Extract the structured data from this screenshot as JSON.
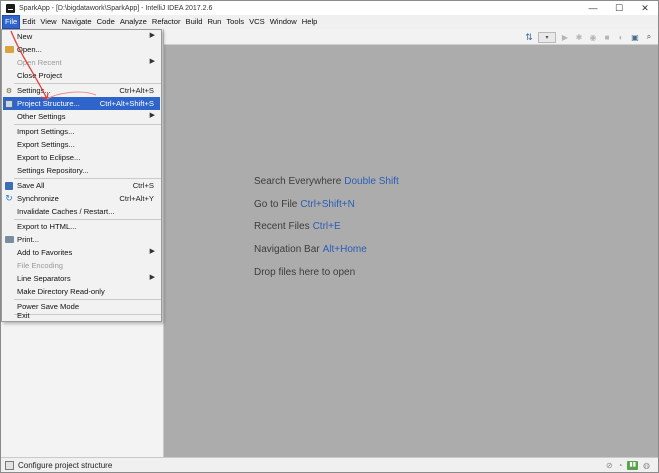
{
  "window": {
    "title": "SparkApp - [D:\\bigdatawork\\SparkApp] - IntelliJ IDEA 2017.2.6",
    "controls": {
      "minimize": "—",
      "maximize": "☐",
      "close": "✕"
    }
  },
  "menubar": {
    "items": [
      {
        "label": "File"
      },
      {
        "label": "Edit"
      },
      {
        "label": "View"
      },
      {
        "label": "Navigate"
      },
      {
        "label": "Code"
      },
      {
        "label": "Analyze"
      },
      {
        "label": "Refactor"
      },
      {
        "label": "Build"
      },
      {
        "label": "Run"
      },
      {
        "label": "Tools"
      },
      {
        "label": "VCS"
      },
      {
        "label": "Window"
      },
      {
        "label": "Help"
      }
    ]
  },
  "file_menu": {
    "items": [
      {
        "label": "New",
        "shortcut": "",
        "submenu": true,
        "disabled": false,
        "icon": ""
      },
      {
        "label": "Open...",
        "shortcut": "",
        "submenu": false,
        "disabled": false,
        "icon": "folder-icon"
      },
      {
        "label": "Open Recent",
        "shortcut": "",
        "submenu": true,
        "disabled": true,
        "icon": ""
      },
      {
        "label": "Close Project",
        "shortcut": "",
        "submenu": false,
        "disabled": false,
        "icon": ""
      },
      {
        "label": "Settings...",
        "shortcut": "Ctrl+Alt+S",
        "submenu": false,
        "disabled": false,
        "icon": "wrench-icon"
      },
      {
        "label": "Project Structure...",
        "shortcut": "Ctrl+Alt+Shift+S",
        "submenu": false,
        "disabled": false,
        "selected": true,
        "icon": "project-structure-icon"
      },
      {
        "label": "Other Settings",
        "shortcut": "",
        "submenu": true,
        "disabled": false,
        "icon": ""
      },
      {
        "label": "Import Settings...",
        "shortcut": "",
        "submenu": false,
        "disabled": false,
        "icon": ""
      },
      {
        "label": "Export Settings...",
        "shortcut": "",
        "submenu": false,
        "disabled": false,
        "icon": ""
      },
      {
        "label": "Export to Eclipse...",
        "shortcut": "",
        "submenu": false,
        "disabled": false,
        "icon": ""
      },
      {
        "label": "Settings Repository...",
        "shortcut": "",
        "submenu": false,
        "disabled": false,
        "icon": ""
      },
      {
        "label": "Save All",
        "shortcut": "Ctrl+S",
        "submenu": false,
        "disabled": false,
        "icon": "save-icon"
      },
      {
        "label": "Synchronize",
        "shortcut": "Ctrl+Alt+Y",
        "submenu": false,
        "disabled": false,
        "icon": "sync-icon"
      },
      {
        "label": "Invalidate Caches / Restart...",
        "shortcut": "",
        "submenu": false,
        "disabled": false,
        "icon": ""
      },
      {
        "label": "Export to HTML...",
        "shortcut": "",
        "submenu": false,
        "disabled": false,
        "icon": ""
      },
      {
        "label": "Print...",
        "shortcut": "",
        "submenu": false,
        "disabled": false,
        "icon": "print-icon"
      },
      {
        "label": "Add to Favorites",
        "shortcut": "",
        "submenu": true,
        "disabled": false,
        "icon": ""
      },
      {
        "label": "File Encoding",
        "shortcut": "",
        "submenu": false,
        "disabled": true,
        "icon": ""
      },
      {
        "label": "Line Separators",
        "shortcut": "",
        "submenu": true,
        "disabled": false,
        "icon": ""
      },
      {
        "label": "Make Directory Read-only",
        "shortcut": "",
        "submenu": false,
        "disabled": false,
        "icon": ""
      },
      {
        "label": "Power Save Mode",
        "shortcut": "",
        "submenu": false,
        "disabled": false,
        "icon": ""
      },
      {
        "label": "Exit",
        "shortcut": "",
        "submenu": false,
        "disabled": false,
        "icon": ""
      }
    ]
  },
  "editor": {
    "hints": [
      {
        "text": "Search Everywhere",
        "key": "Double Shift"
      },
      {
        "text": "Go to File",
        "key": "Ctrl+Shift+N"
      },
      {
        "text": "Recent Files",
        "key": "Ctrl+E"
      },
      {
        "text": "Navigation Bar",
        "key": "Alt+Home"
      },
      {
        "text": "Drop files here to open",
        "key": ""
      }
    ]
  },
  "statusbar": {
    "text": "Configure project structure"
  },
  "colors": {
    "accent": "#2f65ca",
    "editor_bg": "#acacac",
    "shortcut_key": "#2a5fb4",
    "annotation": "#e0403a"
  }
}
